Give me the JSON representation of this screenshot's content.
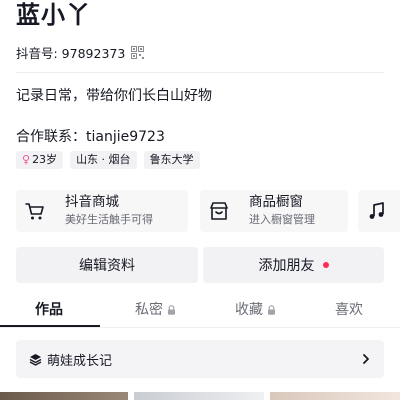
{
  "profile": {
    "name": "蓝小丫",
    "id_text": "抖音号: 97892373",
    "bio": "记录日常，带给你们长白山好物",
    "contact": "合作联系：tianjie9723",
    "tags": [
      {
        "icon": "female-icon",
        "icon_glyph": "♀",
        "label": "23岁"
      },
      {
        "label": "山东 · 烟台"
      },
      {
        "label": "鲁东大学"
      }
    ]
  },
  "shortcuts": [
    {
      "icon": "cart-icon",
      "title": "抖音商城",
      "subtitle": "美好生活触手可得"
    },
    {
      "icon": "storefront-icon",
      "title": "商品橱窗",
      "subtitle": "进入橱窗管理"
    },
    {
      "icon": "music-note-icon"
    }
  ],
  "actions": {
    "edit_label": "编辑资料",
    "add_friends_label": "添加朋友"
  },
  "tabs": [
    {
      "label": "作品",
      "active": true,
      "locked": false
    },
    {
      "label": "私密",
      "active": false,
      "locked": true
    },
    {
      "label": "收藏",
      "active": false,
      "locked": true
    },
    {
      "label": "喜欢",
      "active": false,
      "locked": false
    }
  ],
  "album": {
    "icon": "layers-icon",
    "label": "萌娃成长记"
  },
  "colors": {
    "accent_red": "#fe2c55",
    "text_primary": "#161823",
    "text_secondary": "#686a73",
    "female_pink": "#f2559d"
  }
}
